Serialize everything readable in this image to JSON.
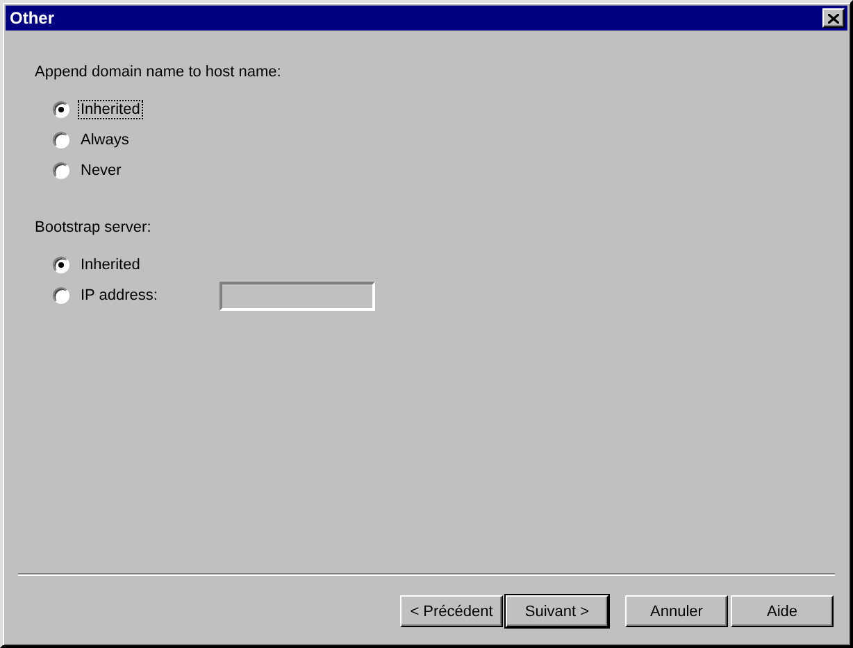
{
  "window": {
    "title": "Other"
  },
  "groups": [
    {
      "label": "Append domain name to host name:",
      "options": [
        {
          "label": "Inherited",
          "selected": true,
          "focused": true,
          "kind": "plain"
        },
        {
          "label": "Always",
          "selected": false,
          "focused": false,
          "kind": "plain"
        },
        {
          "label": "Never",
          "selected": false,
          "focused": false,
          "kind": "plain"
        }
      ]
    },
    {
      "label": "Bootstrap server:",
      "options": [
        {
          "label": "Inherited",
          "selected": true,
          "focused": false,
          "kind": "plain"
        },
        {
          "label": "IP address:",
          "selected": false,
          "focused": false,
          "kind": "field",
          "field": {
            "disabled": true
          }
        }
      ]
    }
  ],
  "buttons": [
    {
      "label": "< Précédent",
      "default": false
    },
    {
      "label": "Suivant >",
      "default": true
    },
    {
      "label": "Annuler",
      "default": false
    },
    {
      "label": "Aide",
      "default": false
    }
  ]
}
